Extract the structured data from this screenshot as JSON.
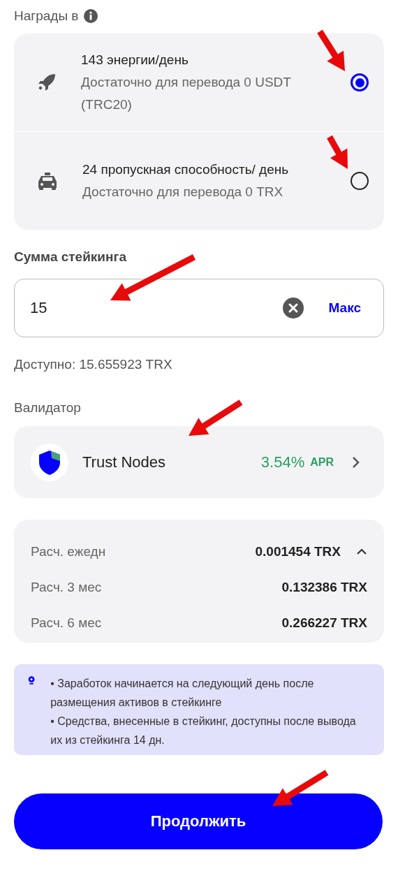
{
  "rewards": {
    "label": "Награды в",
    "options": [
      {
        "kind": "energy",
        "title": "143 энергии/день",
        "subtitle": "Достаточно для перевода 0 USDT (TRC20)",
        "selected": true
      },
      {
        "kind": "bandwidth",
        "title": "24 пропускная способность/ день",
        "subtitle": "Достаточно для перевода 0 TRX",
        "selected": false
      }
    ]
  },
  "amount": {
    "label": "Сумма стейкинга",
    "value": "15",
    "max_button": "Макс",
    "available": "Доступно: 15.655923 TRX"
  },
  "validator": {
    "label": "Валидатор",
    "name": "Trust Nodes",
    "apr_value": "3.54%",
    "apr_label": "APR"
  },
  "estimates": {
    "expanded": true,
    "rows": [
      {
        "label": "Расч. ежедн",
        "value": "0.001454 TRX"
      },
      {
        "label": "Расч. 3 мес",
        "value": "0.132386 TRX"
      },
      {
        "label": "Расч. 6 мес",
        "value": "0.266227 TRX"
      }
    ]
  },
  "info": [
    "• Заработок начинается на следующий день после размещения активов в стейкинге",
    "• Средства, внесенные в стейкинг, доступны после вывода их из стейкинга 14 дн."
  ],
  "continue_button": "Продолжить"
}
